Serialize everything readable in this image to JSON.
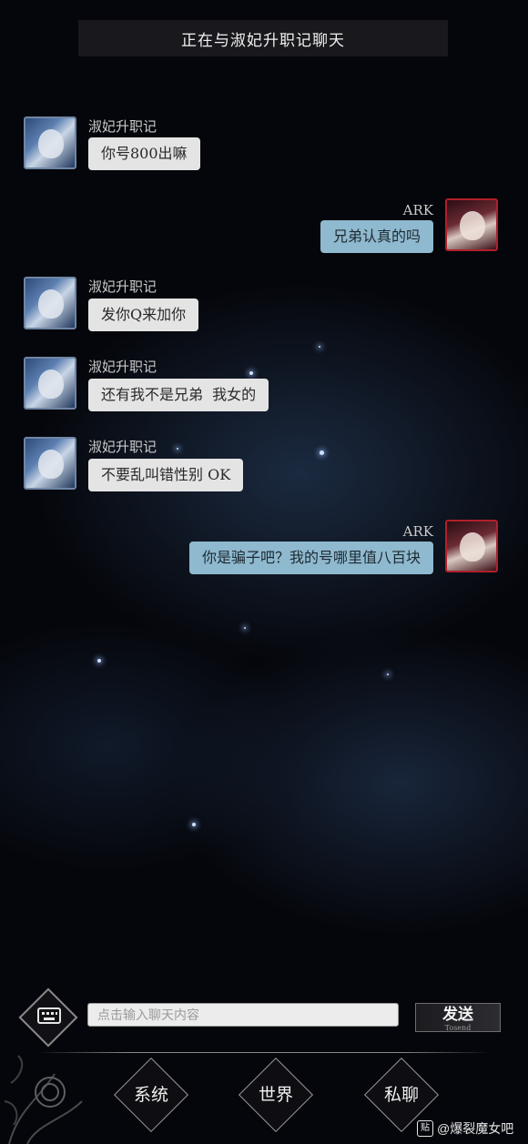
{
  "header": {
    "title": "正在与淑妃升职记聊天"
  },
  "messages": [
    {
      "side": "left",
      "sender": "淑妃升职记",
      "text": "你号800出嘛",
      "avatar_icon": "anime-avatar-blue-icon"
    },
    {
      "side": "right",
      "sender": "ARK",
      "text": "兄弟认真的吗",
      "avatar_icon": "anime-avatar-red-icon"
    },
    {
      "side": "left",
      "sender": "淑妃升职记",
      "text": "发你Q来加你",
      "avatar_icon": "anime-avatar-blue-icon"
    },
    {
      "side": "left",
      "sender": "淑妃升职记",
      "text": "还有我不是兄弟  我女的",
      "avatar_icon": "anime-avatar-blue-icon"
    },
    {
      "side": "left",
      "sender": "淑妃升职记",
      "text": "不要乱叫错性别 OK",
      "avatar_icon": "anime-avatar-blue-icon"
    },
    {
      "side": "right",
      "sender": "ARK",
      "text": "你是骗子吧？我的号哪里值八百块",
      "avatar_icon": "anime-avatar-red-icon"
    }
  ],
  "composer": {
    "placeholder": "点击输入聊天内容",
    "send_label": "发送",
    "send_sublabel": "Tosend",
    "keyboard_icon": "keyboard-icon"
  },
  "tabs": [
    {
      "label": "系统"
    },
    {
      "label": "世界"
    },
    {
      "label": "私聊"
    }
  ],
  "watermark": {
    "text": "@爆裂魔女吧",
    "icon_text": "贴"
  },
  "colors": {
    "left_bubble": "#e4e4e4",
    "right_bubble": "#8fb9ce",
    "background": "#05060b"
  }
}
